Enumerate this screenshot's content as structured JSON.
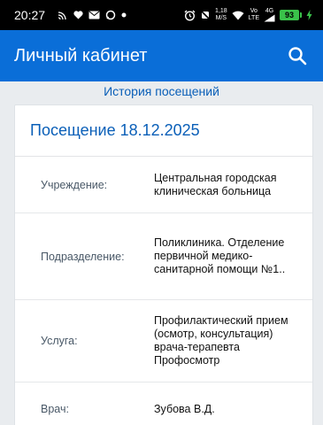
{
  "status_bar": {
    "time": "20:27",
    "net_speed_value": "1,18",
    "net_speed_unit": "M/S",
    "lte_top": "Vo",
    "lte_bottom": "LTE",
    "signal_label": "4G",
    "battery": "93",
    "left_icons": [
      "cast-icon",
      "heart-icon",
      "mail-icon",
      "chat-icon",
      "dot-icon"
    ],
    "right_icons": [
      "alarm-icon",
      "mute-icon",
      "wifi-icon",
      "signal-icon",
      "battery-icon"
    ]
  },
  "app_bar": {
    "title": "Личный кабинет",
    "icon": "search-icon",
    "bg_color": "#0a6ed8"
  },
  "history_link": "История посещений",
  "visit": {
    "title": "Посещение 18.12.2025",
    "fields": [
      {
        "label": "Учреждение:",
        "value": "Центральная городская клиническая больница"
      },
      {
        "label": "Подразделение:",
        "value": "Поликлиника. Отделение первичной медико-санитарной помощи №1.."
      },
      {
        "label": "Услуга:",
        "value": "Профилактический прием (осмотр, консультация) врача-терапевта Профосмотр"
      },
      {
        "label": "Врач:",
        "value": "Зубова В.Д."
      }
    ]
  }
}
